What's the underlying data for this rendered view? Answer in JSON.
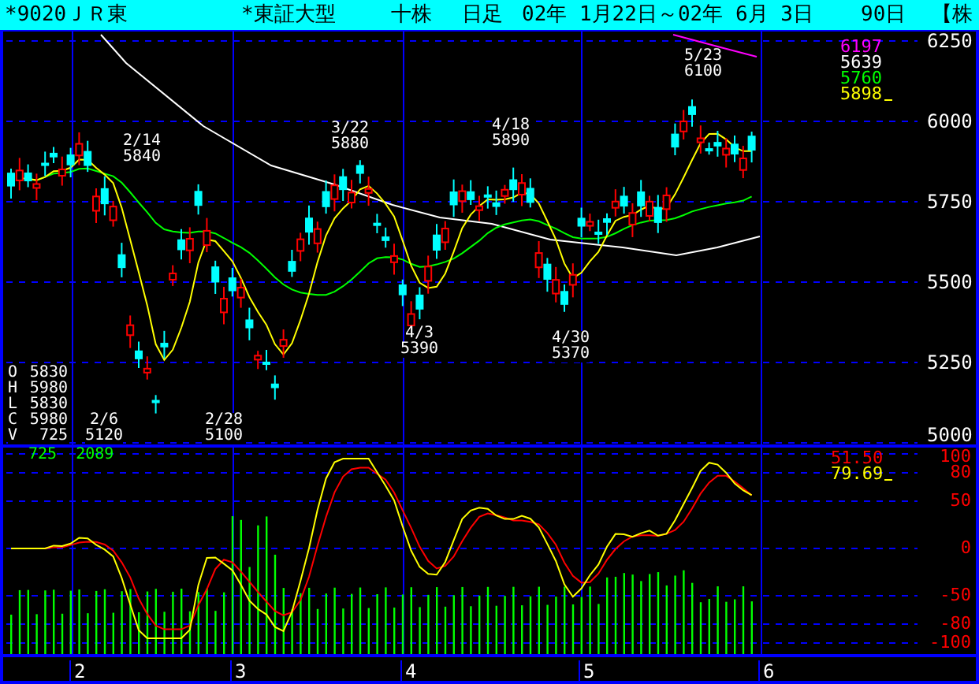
{
  "title_bar": {
    "segments": [
      "*9020ＪＲ東",
      "*東証大型",
      "十株",
      "日足",
      "02年 1月22日～02年 6月 3日",
      "90日",
      "【株"
    ]
  },
  "price_panel": {
    "axis_labels": [
      "6250",
      "6000",
      "5750",
      "5500",
      "5250",
      "5000"
    ],
    "legend": [
      {
        "value": "6197",
        "color": "#ff00ff",
        "cursor": false
      },
      {
        "value": "5639",
        "color": "#ffffff",
        "cursor": false
      },
      {
        "value": "5760",
        "color": "#00ff00",
        "cursor": false
      },
      {
        "value": "5898",
        "color": "#ffff00",
        "cursor": true
      }
    ],
    "annotations": [
      {
        "date": "5/23",
        "price": "6100"
      },
      {
        "date": "3/22",
        "price": "5880"
      },
      {
        "date": "4/18",
        "price": "5890"
      },
      {
        "date": "2/14",
        "price": "5840"
      },
      {
        "date": "4/3",
        "price": "5390"
      },
      {
        "date": "4/30",
        "price": "5370"
      },
      {
        "date": "2/6",
        "price": "5120"
      },
      {
        "date": "2/28",
        "price": "5100"
      }
    ],
    "ohlcv": [
      {
        "letter": "O",
        "value": "5830"
      },
      {
        "letter": "H",
        "value": "5980"
      },
      {
        "letter": "L",
        "value": "5830"
      },
      {
        "letter": "C",
        "value": "5980"
      },
      {
        "letter": "V",
        "value": "725"
      }
    ]
  },
  "oscillator_panel": {
    "volume_labels": [
      "725",
      "2089"
    ],
    "legend": [
      {
        "value": "51.50",
        "color": "#ff0000",
        "cursor": false
      },
      {
        "value": "79.69",
        "color": "#ffff00",
        "cursor": true
      }
    ],
    "axis_labels": [
      "100",
      "80",
      "50",
      "0",
      "-50",
      "-80",
      "-100"
    ]
  },
  "months": [
    "2",
    "3",
    "4",
    "5",
    "6"
  ]
}
